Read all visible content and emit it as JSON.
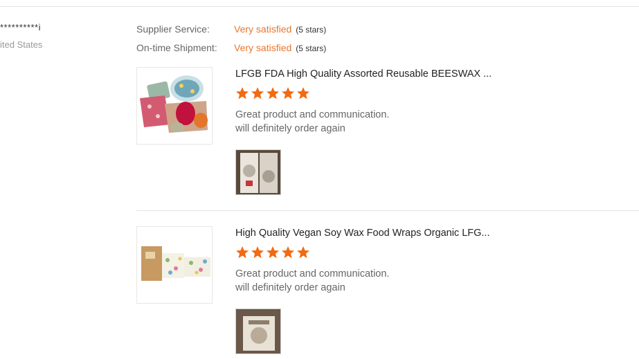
{
  "buyer": {
    "name": "**********i",
    "country": "ited States"
  },
  "ratings": [
    {
      "label": "Supplier Service:",
      "value": "Very satisfied",
      "count": "(5 stars)"
    },
    {
      "label": "On-time Shipment:",
      "value": "Very satisfied",
      "count": "(5 stars)"
    }
  ],
  "colors": {
    "accent": "#e8772e",
    "star": "#f26a12",
    "divider": "#e3e3e3"
  },
  "reviews": [
    {
      "product_title": "LFGB FDA High Quality Assorted Reusable BEESWAX ...",
      "stars": 5,
      "comment_line1": "Great product and communication.",
      "comment_line2": "will definitely order again",
      "thumbnail_icon": "beeswax-wraps-product-image",
      "photo_icon": "customer-photo-image"
    },
    {
      "product_title": "High Quality Vegan Soy Wax Food Wraps Organic LFG...",
      "stars": 5,
      "comment_line1": "Great product and communication.",
      "comment_line2": "will definitely order again",
      "thumbnail_icon": "soy-wax-wraps-product-image",
      "photo_icon": "customer-photo-image"
    }
  ]
}
